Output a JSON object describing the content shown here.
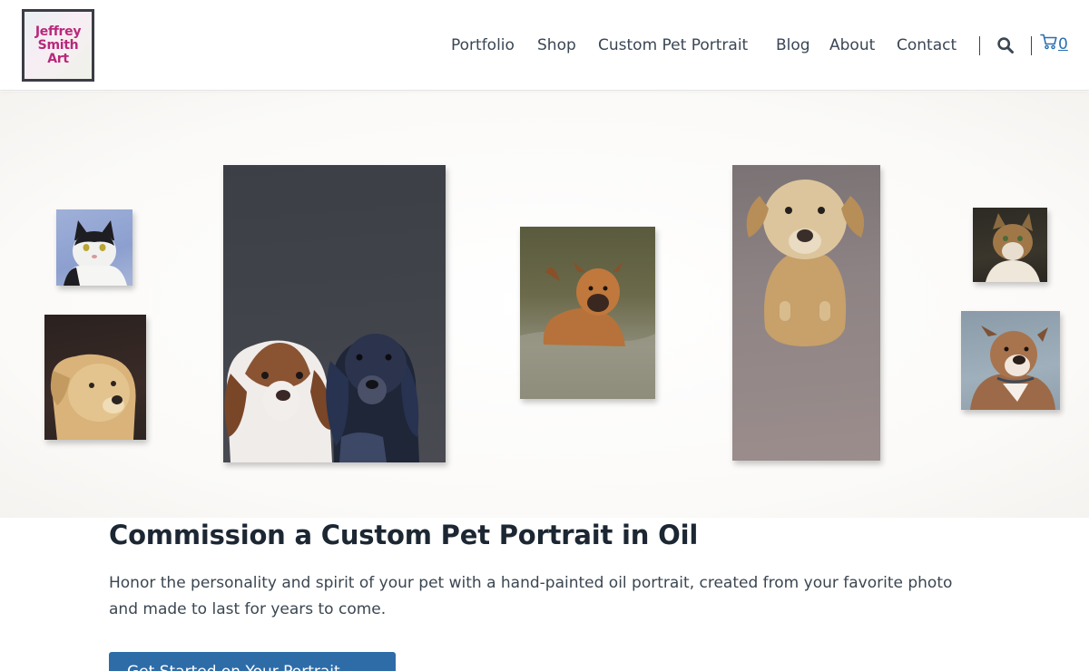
{
  "logo": {
    "line1": "Jeffrey",
    "line2": "Smith",
    "line3": "Art"
  },
  "nav": {
    "items": [
      {
        "label": "Portfolio"
      },
      {
        "label": "Shop"
      },
      {
        "label": "Custom Pet Portrait"
      },
      {
        "label": "Blog"
      },
      {
        "label": "About"
      },
      {
        "label": "Contact"
      }
    ],
    "search_icon": "search-icon",
    "cart_icon": "cart-icon",
    "cart_count": "0"
  },
  "hero": {
    "paintings": [
      {
        "subject": "black and white cat"
      },
      {
        "subject": "golden retriever"
      },
      {
        "subject": "two spaniels"
      },
      {
        "subject": "boxer in water"
      },
      {
        "subject": "yellow lab from above"
      },
      {
        "subject": "tabby cat"
      },
      {
        "subject": "pit bull"
      }
    ]
  },
  "main": {
    "title": "Commission a Custom Pet Portrait in Oil",
    "description": "Honor the personality and spirit of your pet with a hand-painted oil portrait, created from your favorite photo and made to last for years to come.",
    "cta_label": "Get Started on Your Portrait"
  },
  "colors": {
    "accent": "#2e6ca8",
    "logo_text": "#b8287a",
    "heading": "#1c2733",
    "nav_text": "#3a4654"
  }
}
